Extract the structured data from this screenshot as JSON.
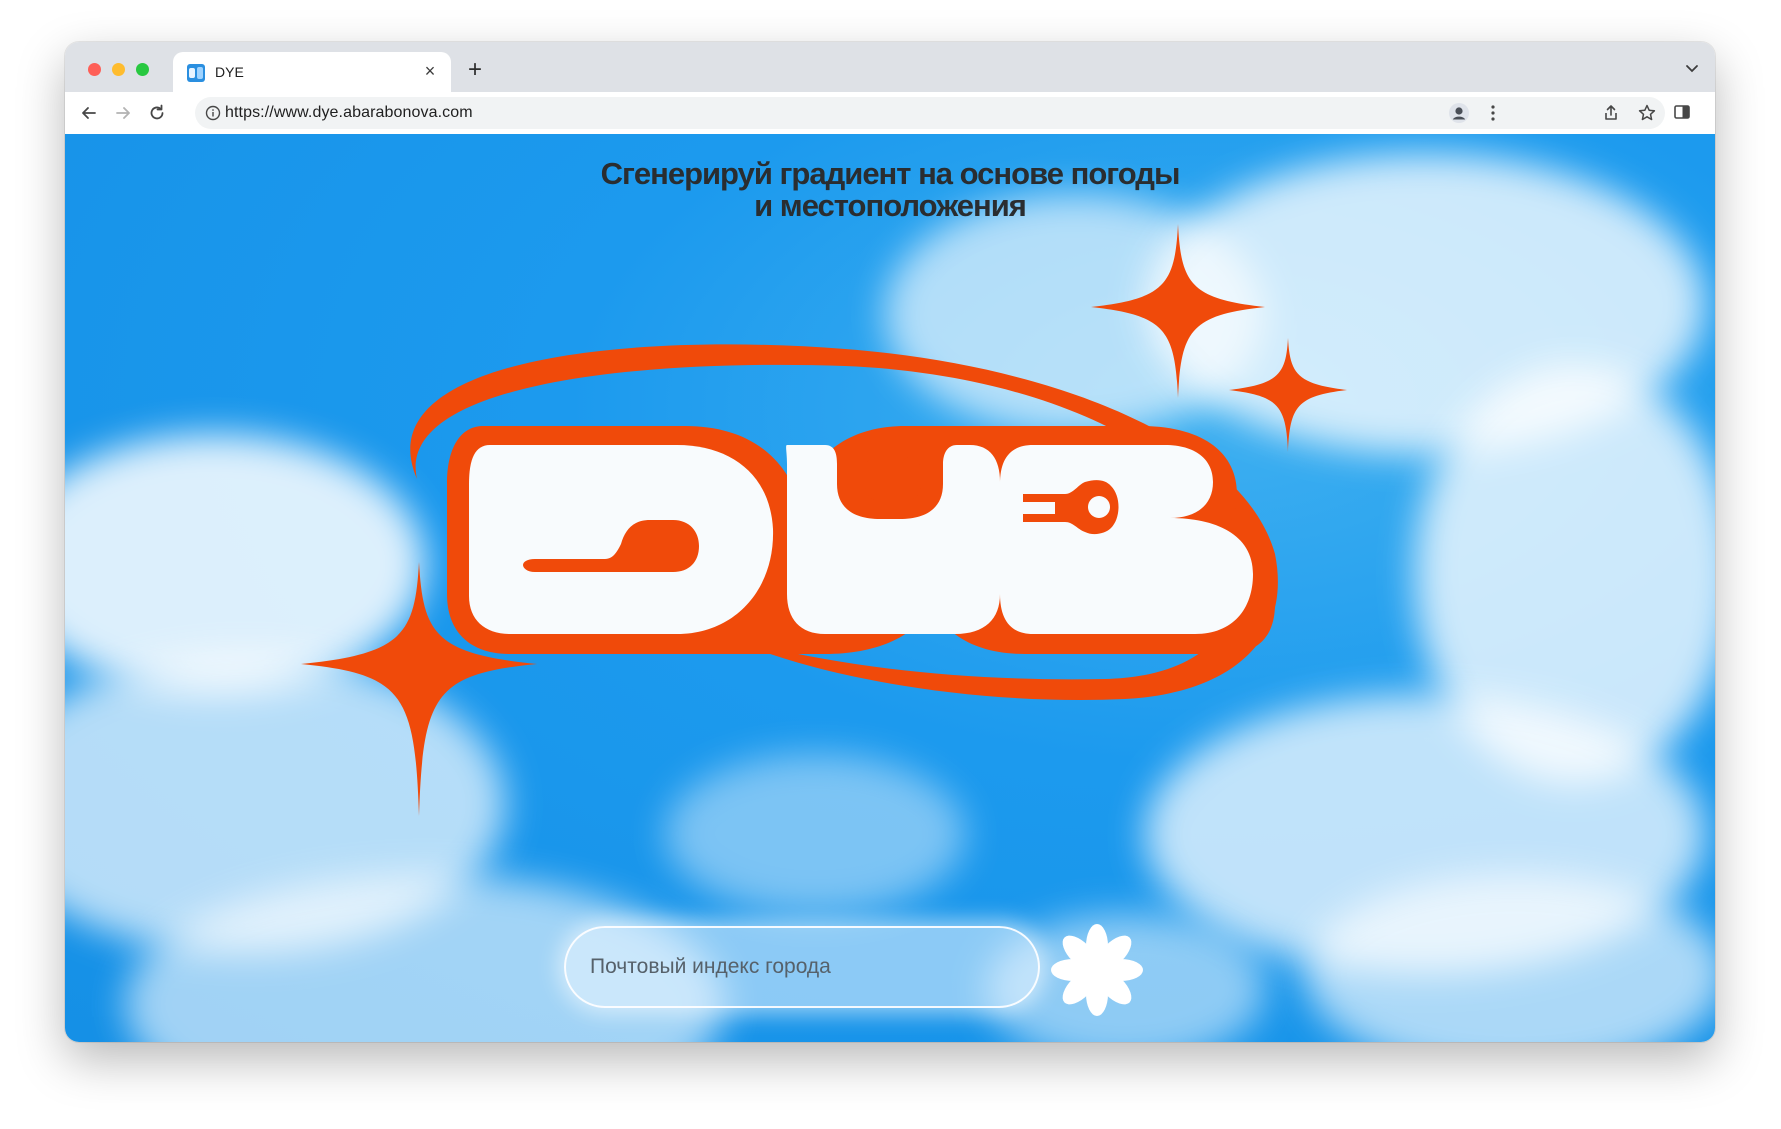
{
  "browser": {
    "tab": {
      "title": "DYE"
    },
    "address_bar": {
      "url": "https://www.dye.abarabonova.com"
    }
  },
  "page": {
    "headline": {
      "line1": "Сгенерируй градиент на основе погоды",
      "line2": "и местоположения"
    },
    "logo": {
      "text": "DYE",
      "accent_color": "#f04a0a",
      "fill_color": "#f8fbfd"
    },
    "search": {
      "placeholder": "Почтовый индекс города",
      "value": ""
    },
    "submit_icon": "white-asterisk-flower-icon",
    "colors": {
      "sky": "#1c9aee",
      "accent": "#f04a0a",
      "headline": "#2a2d30"
    }
  }
}
